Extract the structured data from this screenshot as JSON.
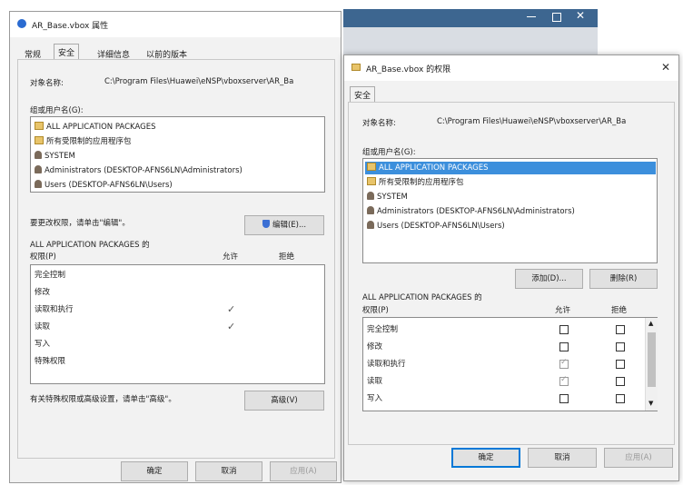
{
  "back_window": {
    "title": "AR_Base.vbox 属性",
    "tabs": [
      "常规",
      "安全",
      "详细信息",
      "以前的版本"
    ],
    "object_label": "对象名称:",
    "object_path": "C:\\Program Files\\Huawei\\eNSP\\vboxserver\\AR_Ba",
    "group_label": "组或用户名(G):",
    "groups": [
      "ALL APPLICATION PACKAGES",
      "所有受限制的应用程序包",
      "SYSTEM",
      "Administrators (DESKTOP-AFNS6LN\\Administrators)",
      "Users (DESKTOP-AFNS6LN\\Users)"
    ],
    "change_hint": "要更改权限，请单击\"编辑\"。",
    "edit_button": "编辑(E)...",
    "perm_title": "ALL APPLICATION PACKAGES 的",
    "perm_label": "权限(P)",
    "allow_col": "允许",
    "deny_col": "拒绝",
    "permissions": [
      {
        "name": "完全控制",
        "allow": false
      },
      {
        "name": "修改",
        "allow": false
      },
      {
        "name": "读取和执行",
        "allow": true
      },
      {
        "name": "读取",
        "allow": true
      },
      {
        "name": "写入",
        "allow": false
      },
      {
        "name": "特殊权限",
        "allow": false
      }
    ],
    "advanced_hint": "有关特殊权限或高级设置，请单击\"高级\"。",
    "advanced_button": "高级(V)",
    "ok_button": "确定",
    "cancel_button": "取消",
    "apply_button": "应用(A)"
  },
  "front_window": {
    "title": "AR_Base.vbox 的权限",
    "tab": "安全",
    "object_label": "对象名称:",
    "object_path": "C:\\Program Files\\Huawei\\eNSP\\vboxserver\\AR_Ba",
    "group_label": "组或用户名(G):",
    "groups": [
      "ALL APPLICATION PACKAGES",
      "所有受限制的应用程序包",
      "SYSTEM",
      "Administrators (DESKTOP-AFNS6LN\\Administrators)",
      "Users (DESKTOP-AFNS6LN\\Users)"
    ],
    "add_button": "添加(D)...",
    "remove_button": "删除(R)",
    "perm_title": "ALL APPLICATION PACKAGES 的",
    "perm_label": "权限(P)",
    "allow_col": "允许",
    "deny_col": "拒绝",
    "permissions": [
      {
        "name": "完全控制",
        "allow": false,
        "deny": false
      },
      {
        "name": "修改",
        "allow": false,
        "deny": false
      },
      {
        "name": "读取和执行",
        "allow": true,
        "deny": false
      },
      {
        "name": "读取",
        "allow": true,
        "deny": false
      },
      {
        "name": "写入",
        "allow": false,
        "deny": false
      }
    ],
    "ok_button": "确定",
    "cancel_button": "取消",
    "apply_button": "应用(A)"
  },
  "colors": {
    "accent": "#0078d7",
    "selection": "#3c8fdc",
    "backdrop": "#4a6f96"
  }
}
